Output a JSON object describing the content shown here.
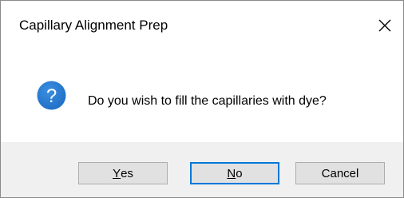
{
  "window": {
    "title": "Capillary Alignment Prep",
    "close_glyph": "✕"
  },
  "message": {
    "icon": "question-icon",
    "text": "Do you wish to fill the capillaries with dye?"
  },
  "buttons": {
    "yes": {
      "mnemonic": "Y",
      "rest": "es"
    },
    "no": {
      "mnemonic": "N",
      "rest": "o"
    },
    "cancel": {
      "label": "Cancel"
    }
  },
  "colors": {
    "icon_blue": "#1f6fc5",
    "focus_border": "#0078d7",
    "footer_bg": "#f0f0f0",
    "button_bg": "#e1e1e1"
  }
}
